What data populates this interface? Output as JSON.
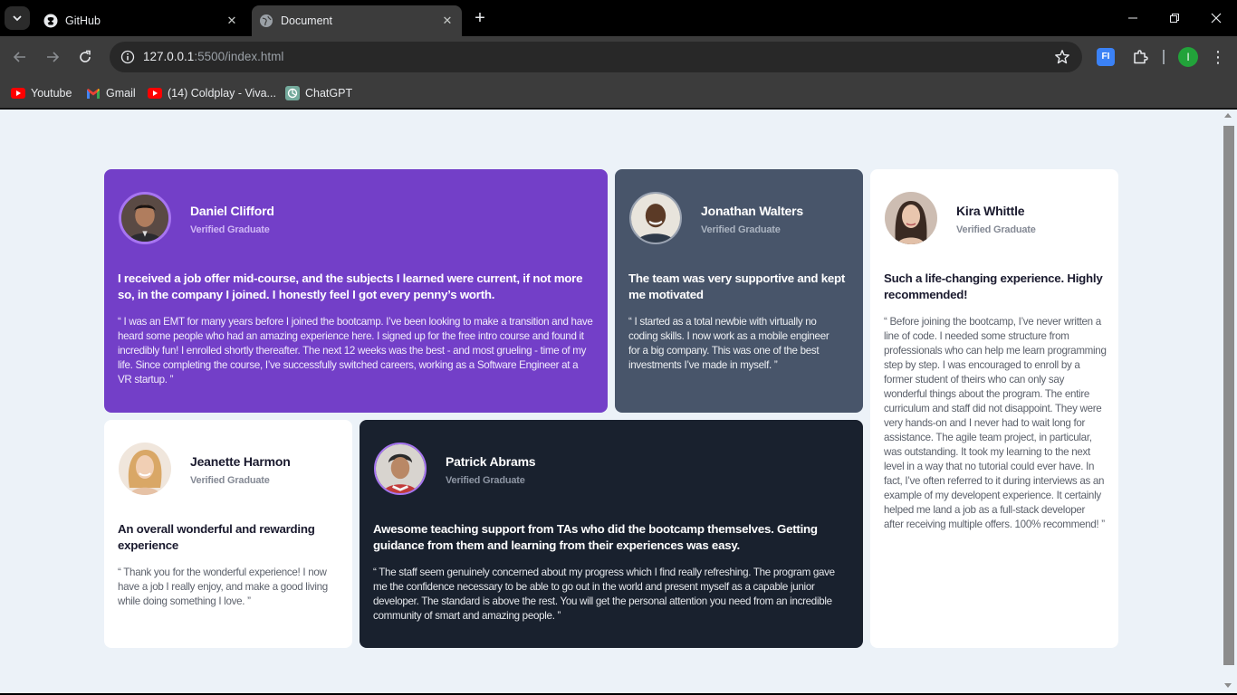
{
  "browser": {
    "tabs": [
      {
        "title": "GitHub",
        "favicon": "github-icon",
        "active": false
      },
      {
        "title": "Document",
        "favicon": "globe-icon",
        "active": true
      }
    ],
    "url_host": "127.0.0.1",
    "url_path": ":5500/index.html",
    "extension_label": "FI",
    "profile_initial": "I",
    "bookmarks": [
      {
        "label": "Youtube",
        "icon": "youtube-icon"
      },
      {
        "label": "Gmail",
        "icon": "gmail-icon"
      },
      {
        "label": "(14) Coldplay - Viva...",
        "icon": "youtube-icon"
      },
      {
        "label": "ChatGPT",
        "icon": "chatgpt-icon"
      }
    ]
  },
  "testimonials": [
    {
      "name": "Daniel Clifford",
      "role": "Verified Graduate",
      "headline": "I received a job offer mid-course, and the subjects I learned were current, if not more so, in the company I joined. I honestly feel I got every penny’s worth.",
      "quote": "“ I was an EMT for many years before I joined the bootcamp. I’ve been looking to make a transition and have heard some people who had an amazing experience here. I signed up for the free intro course and found it incredibly fun! I enrolled shortly thereafter. The next 12 weeks was the best - and most grueling - time of my life. Since completing the course, I’ve successfully switched careers, working as a Software Engineer at a VR startup. ”"
    },
    {
      "name": "Jonathan Walters",
      "role": "Verified Graduate",
      "headline": "The team was very supportive and kept me motivated",
      "quote": "“ I started as a total newbie with virtually no coding skills. I now work as a mobile engineer for a big company. This was one of the best investments I’ve made in myself. ”"
    },
    {
      "name": "Kira Whittle",
      "role": "Verified Graduate",
      "headline": "Such a life-changing experience. Highly recommended!",
      "quote": "“ Before joining the bootcamp, I’ve never written a line of code. I needed some structure from professionals who can help me learn programming step by step. I was encouraged to enroll by a former student of theirs who can only say wonderful things about the program. The entire curriculum and staff did not disappoint. They were very hands-on and I never had to wait long for assistance. The agile team project, in particular, was outstanding. It took my learning to the next level in a way that no tutorial could ever have. In fact, I’ve often referred to it during interviews as an example of my developent experience. It certainly helped me land a job as a full-stack developer after receiving multiple offers. 100% recommend! ”"
    },
    {
      "name": "Jeanette Harmon",
      "role": "Verified Graduate",
      "headline": "An overall wonderful and rewarding experience",
      "quote": "“ Thank you for the wonderful experience! I now have a job I really enjoy, and make a good living while doing something I love. ”"
    },
    {
      "name": "Patrick Abrams",
      "role": "Verified Graduate",
      "headline": "Awesome teaching support from TAs who did the bootcamp themselves. Getting guidance from them and learning from their experiences was easy.",
      "quote": "“ The staff seem genuinely concerned about my progress which I find really refreshing. The program gave me the confidence necessary to be able to go out in the world and present myself as a capable junior developer. The standard is above the rest. You will get the personal attention you need from an incredible community of smart and amazing people. ”"
    }
  ],
  "colors": {
    "page_bg": "#ecf2f8",
    "purple": "#733fc8",
    "slate": "#48556a",
    "navy": "#19212e",
    "white": "#ffffff"
  }
}
